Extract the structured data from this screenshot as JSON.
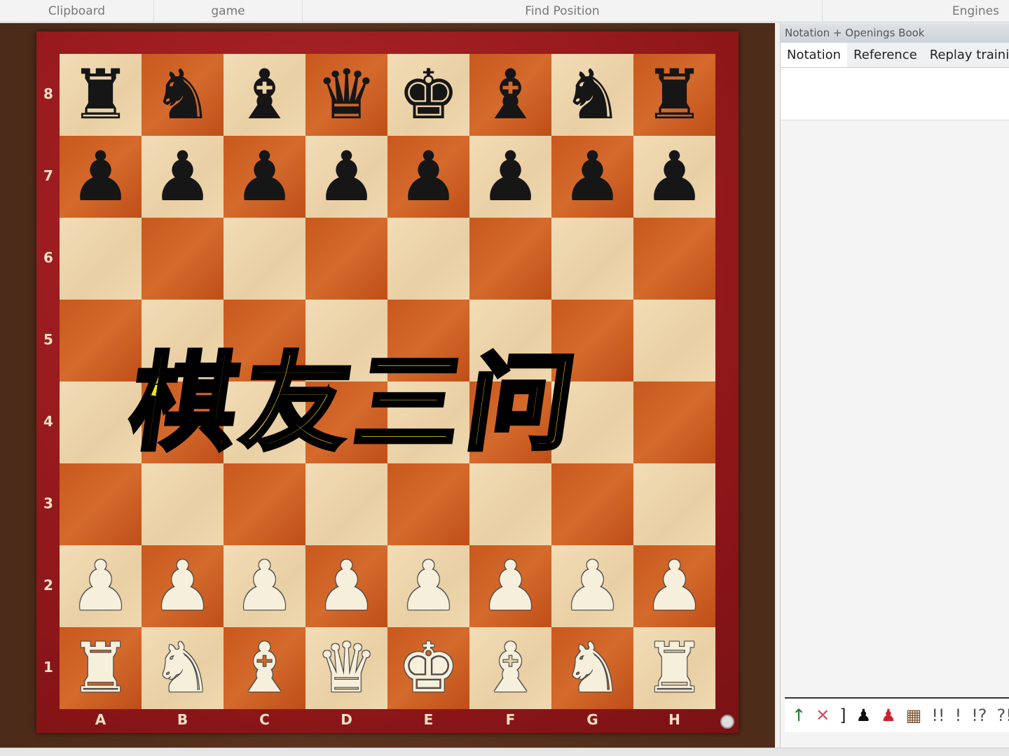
{
  "ribbon": {
    "groups": [
      {
        "label": "Clipboard"
      },
      {
        "label": "game"
      },
      {
        "label": "Find Position"
      },
      {
        "label": "Engines"
      }
    ]
  },
  "board": {
    "ranks": [
      "8",
      "7",
      "6",
      "5",
      "4",
      "3",
      "2",
      "1"
    ],
    "files": [
      "A",
      "B",
      "C",
      "D",
      "E",
      "F",
      "G",
      "H"
    ],
    "position": [
      "rnbqkbnr",
      "pppppppp",
      "........",
      "........",
      "........",
      "........",
      "PPPPPPPP",
      "RNBQKBNR"
    ]
  },
  "caption": "棋友三问",
  "panel": {
    "title": "Notation + Openings Book",
    "tabs": [
      {
        "label": "Notation"
      },
      {
        "label": "Reference"
      },
      {
        "label": "Replay trainin"
      }
    ]
  },
  "annotations": [
    {
      "icon": "arrow-up-icon",
      "glyph": "↑",
      "color": "#1a7a2a"
    },
    {
      "icon": "delete-icon",
      "glyph": "✕",
      "color": "#d05060"
    },
    {
      "icon": "bracket-icon",
      "glyph": "]",
      "color": "#222"
    },
    {
      "icon": "black-pawn-icon",
      "glyph": "♟",
      "color": "#111"
    },
    {
      "icon": "red-pawn-icon",
      "glyph": "♟",
      "color": "#d02030"
    },
    {
      "icon": "board-icon",
      "glyph": "▦",
      "color": "#7a5030"
    },
    {
      "icon": "brilliant",
      "glyph": "!!",
      "color": "#555"
    },
    {
      "icon": "good",
      "glyph": "!",
      "color": "#555"
    },
    {
      "icon": "interesting",
      "glyph": "!?",
      "color": "#555"
    },
    {
      "icon": "dubious",
      "glyph": "?!",
      "color": "#555"
    }
  ]
}
